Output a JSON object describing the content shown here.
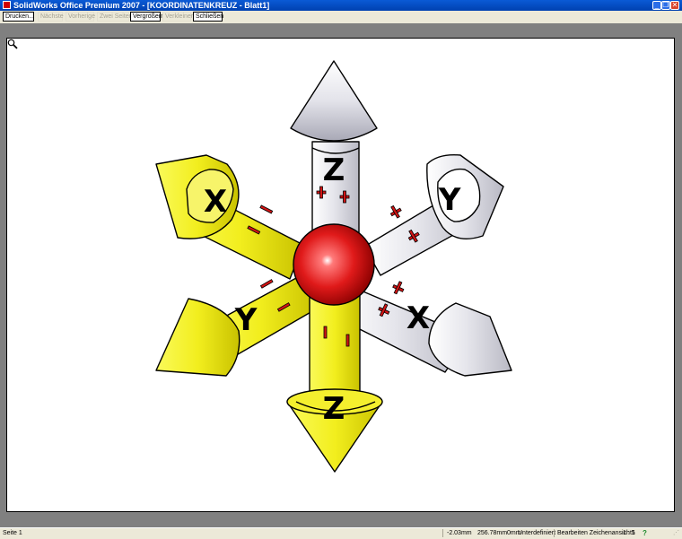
{
  "window": {
    "title": "SolidWorks Office Premium 2007 - [KOORDINATENKREUZ - Blatt1]",
    "minimize": "_",
    "restore": "❐",
    "close": "✕"
  },
  "toolbar": {
    "buttons": [
      {
        "label": "Drucken...",
        "enabled": true
      },
      {
        "label": "Nächste",
        "enabled": false
      },
      {
        "label": "Vorherige",
        "enabled": false
      },
      {
        "label": "Zwei Seiten",
        "enabled": false
      },
      {
        "label": "Vergrößern",
        "enabled": true
      },
      {
        "label": "Verkleinern",
        "enabled": false
      },
      {
        "label": "Schließen",
        "enabled": true
      }
    ]
  },
  "drawing": {
    "arrow_labels": {
      "z_top": "Z",
      "z_bottom": "Z",
      "x_left": "X",
      "x_right": "X",
      "y_left": "Y",
      "y_right": "Y"
    },
    "colors": {
      "positive_axis": "#e6e6ec",
      "negative_axis": "#f2ee1e",
      "sphere": "#e01a1a",
      "signs": "#d21414"
    },
    "icons": {
      "cursor": "magnifier-icon"
    }
  },
  "statusbar": {
    "page": "Seite 1",
    "x_coord": "-2.03mm",
    "y_coord": "256.78mm",
    "z_coord": "0mm",
    "definition_state": "Unterdefiniert",
    "mode": "Bearbeiten Zeichenansicht1",
    "scale": "1 : 5",
    "help_icon": "?"
  }
}
